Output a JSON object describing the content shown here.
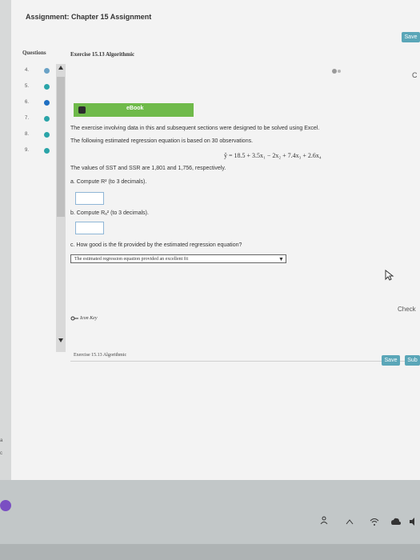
{
  "header": {
    "assignment_title": "Assignment: Chapter 15 Assignment",
    "save_button": "Save"
  },
  "questions_panel": {
    "title": "Questions",
    "items": [
      {
        "num": "4.",
        "status": "partial"
      },
      {
        "num": "5.",
        "status": "correct"
      },
      {
        "num": "6.",
        "status": "current"
      },
      {
        "num": "7.",
        "status": "correct"
      },
      {
        "num": "8.",
        "status": "correct"
      },
      {
        "num": "9.",
        "status": "correct"
      }
    ]
  },
  "exercise": {
    "title": "Exercise 15.13 Algorithmic",
    "right_letter": "C",
    "ebook_label": "eBook",
    "intro": "The exercise involving data in this and subsequent sections were designed to be solved using Excel.",
    "equation_intro": "The following estimated regression equation is based on 30 observations.",
    "equation": "ŷ = 18.5 + 3.5x₁ − 2x₂ + 7.4x₃ + 2.6x₄",
    "values_text": "The values of SST and SSR are 1,801 and 1,756, respectively.",
    "part_a": "a. Compute R² (to 3 decimals).",
    "part_b": "b. Compute Rₐ² (to 3 decimals).",
    "part_c": "c. How good is the fit provided by the estimated regression equation?",
    "select_value": "The estimated regression equation provided an excellent fit",
    "check_label": "Check",
    "icon_key": "Icon Key",
    "footer_title": "Exercise 15.13 Algorithmic"
  },
  "bottom_buttons": {
    "save": "Save",
    "submit": "Sub"
  },
  "taskbar": {
    "left_letters": [
      "a",
      "c"
    ]
  },
  "colors": {
    "ebook_green": "#6fba4a",
    "correct": "#2aa4a8",
    "partial": "#6aa2c6",
    "current": "#1f6fc2",
    "button": "#5aa6b8"
  }
}
